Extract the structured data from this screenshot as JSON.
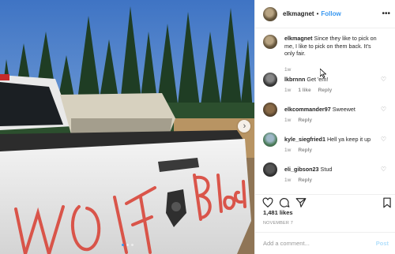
{
  "header": {
    "username": "elkmagnet",
    "separator": "•",
    "follow_label": "Follow",
    "more_icon": "more-options-icon",
    "more_glyph": "•••"
  },
  "photo": {
    "painted_text": "Wolf Blood",
    "next_glyph": "›",
    "carousel_count": 3,
    "carousel_active": 1
  },
  "caption": {
    "username": "elkmagnet",
    "text": " Since they like to pick on me, I like to pick on them back. It's only fair.",
    "time": "1w"
  },
  "comments": [
    {
      "username": "lkbrnnn",
      "text": " Get 'em!",
      "time": "1w",
      "likes": "1 like",
      "reply": "Reply"
    },
    {
      "username": "elkcommander97",
      "text": " Sweewet",
      "time": "1w",
      "likes": "",
      "reply": "Reply"
    },
    {
      "username": "kyle_siegfried1",
      "text": " Hell ya keep it up",
      "time": "1w",
      "likes": "",
      "reply": "Reply"
    },
    {
      "username": "eli_gibson23",
      "text": " Stud",
      "time": "1w",
      "likes": "",
      "reply": "Reply"
    }
  ],
  "actions": {
    "like_icon": "heart-icon",
    "comment_icon": "comment-icon",
    "share_icon": "share-icon",
    "save_icon": "bookmark-icon"
  },
  "likes_count": "1,481 likes",
  "date": "NOVEMBER 7",
  "add_comment": {
    "placeholder": "Add a comment...",
    "post_label": "Post"
  },
  "colors": {
    "link_blue": "#3897f0",
    "post_disabled": "#b2dffc",
    "meta_gray": "#8e8e8e",
    "paint_red": "#d9463a"
  }
}
